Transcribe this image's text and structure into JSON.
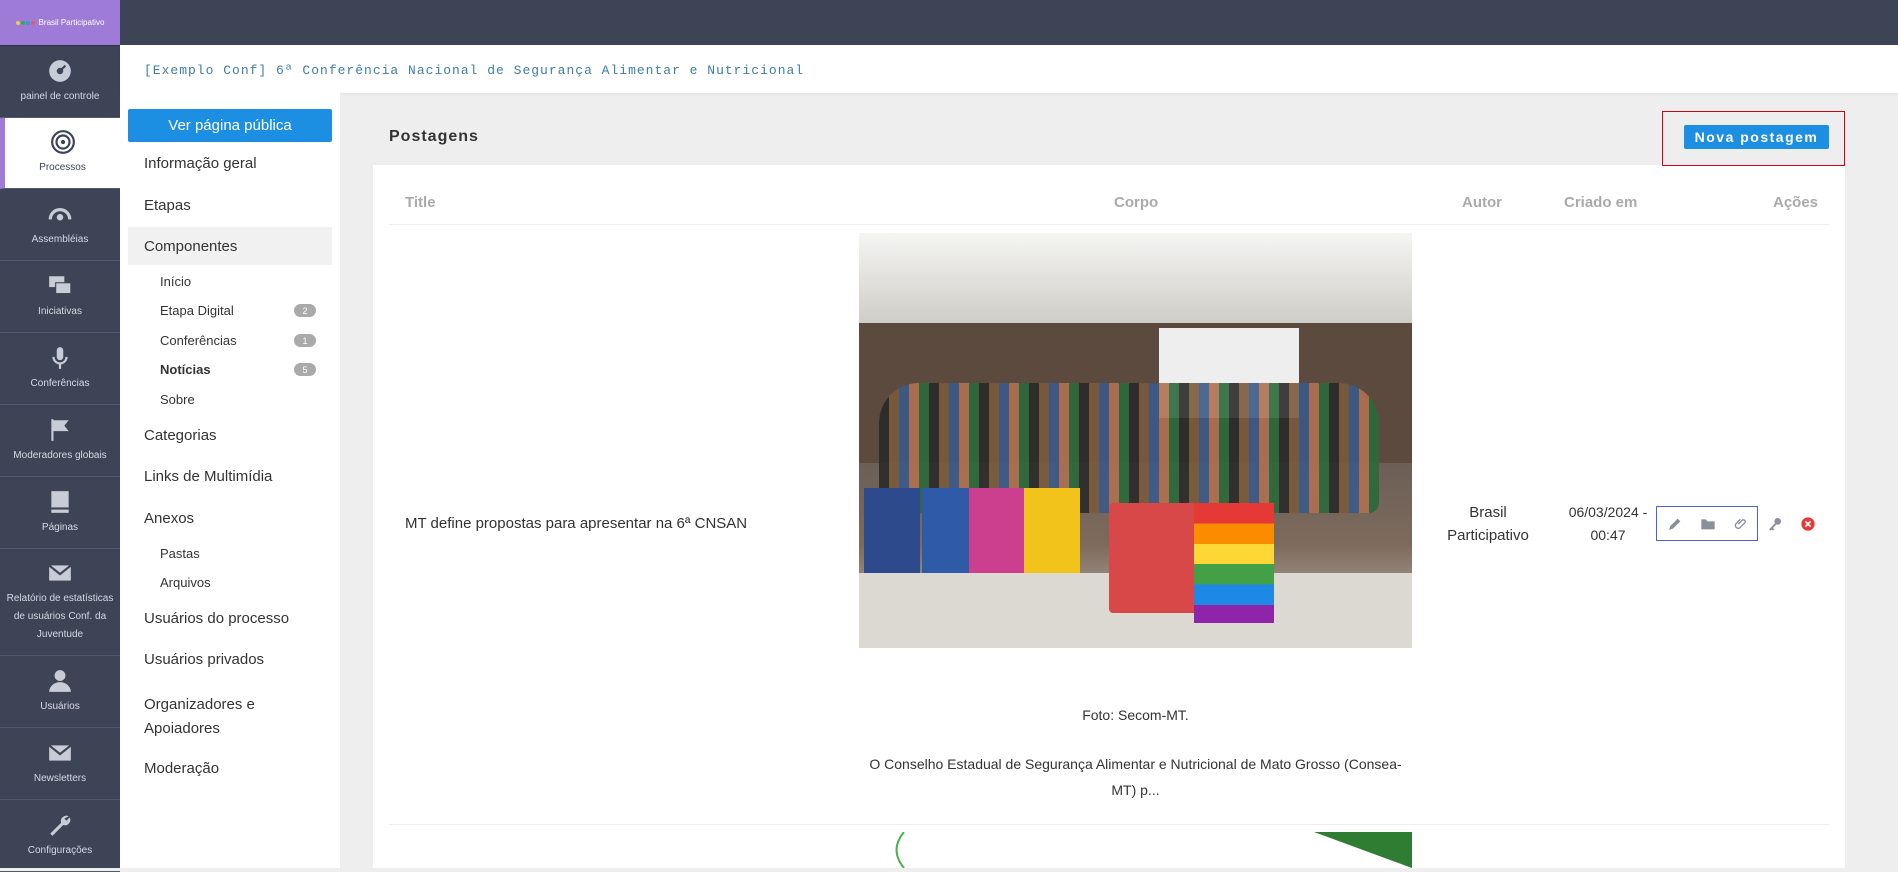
{
  "logo": {
    "text": "Brasil Participativo",
    "dot_colors": [
      "#f2c94c",
      "#27ae60",
      "#2d9cdb",
      "#eb5757"
    ]
  },
  "sidebar": {
    "items": [
      {
        "label": "painel de controle",
        "icon": "dashboard-icon"
      },
      {
        "label": "Processos",
        "icon": "target-icon",
        "active": true
      },
      {
        "label": "Assembléias",
        "icon": "assembly-icon"
      },
      {
        "label": "Iniciativas",
        "icon": "chat-icon"
      },
      {
        "label": "Conferências",
        "icon": "microphone-icon"
      },
      {
        "label": "Moderadores globais",
        "icon": "flag-icon"
      },
      {
        "label": "Páginas",
        "icon": "book-icon"
      },
      {
        "label": "Relatório de estatísticas de usuários Conf. da Juventude",
        "icon": "mail-icon"
      },
      {
        "label": "Usuários",
        "icon": "user-icon"
      },
      {
        "label": "Newsletters",
        "icon": "newsletter-icon"
      },
      {
        "label": "Configurações",
        "icon": "wrench-icon"
      }
    ]
  },
  "breadcrumb": "[Exemplo Conf] 6ª Conferência Nacional de Segurança Alimentar e Nutricional",
  "secondary_nav": {
    "public_button": "Ver página pública",
    "items": [
      {
        "label": "Informação geral"
      },
      {
        "label": "Etapas"
      },
      {
        "label": "Componentes",
        "active": true
      },
      {
        "label": "Categorias"
      },
      {
        "label": "Links de Multimídia"
      },
      {
        "label": "Anexos"
      },
      {
        "label": "Usuários do processo"
      },
      {
        "label": "Usuários privados"
      },
      {
        "label": "Organizadores e Apoiadores"
      },
      {
        "label": "Moderação"
      }
    ],
    "components": [
      {
        "label": "Início"
      },
      {
        "label": "Etapa Digital",
        "badge": "2"
      },
      {
        "label": "Conferências",
        "badge": "1"
      },
      {
        "label": "Notícias",
        "badge": "5",
        "active": true
      },
      {
        "label": "Sobre"
      }
    ],
    "attachments": [
      {
        "label": "Pastas"
      },
      {
        "label": "Arquivos"
      }
    ]
  },
  "card": {
    "title": "Postagens",
    "new_button": "Nova postagem",
    "columns": {
      "title": "Title",
      "body": "Corpo",
      "author": "Autor",
      "created": "Criado em",
      "actions": "Ações"
    },
    "rows": [
      {
        "title": "MT define propostas para apresentar na 6ª CNSAN",
        "caption": "Foto: Secom-MT.",
        "excerpt": "O Conselho Estadual de Segurança Alimentar e Nutricional de Mato Grosso (Consea-MT) p...",
        "author_line1": "Brasil",
        "author_line2": "Participativo",
        "created_line1": "06/03/2024 -",
        "created_line2": "00:47",
        "actions": [
          "pencil-icon",
          "folder-icon",
          "paperclip-icon",
          "key-icon",
          "delete-icon"
        ]
      }
    ]
  },
  "colors": {
    "sidebar": "#3d4456",
    "accent": "#1c8fe3",
    "active_marker": "#9d7bd6",
    "highlight_frame": "#d0021b",
    "delete": "#e53935"
  }
}
